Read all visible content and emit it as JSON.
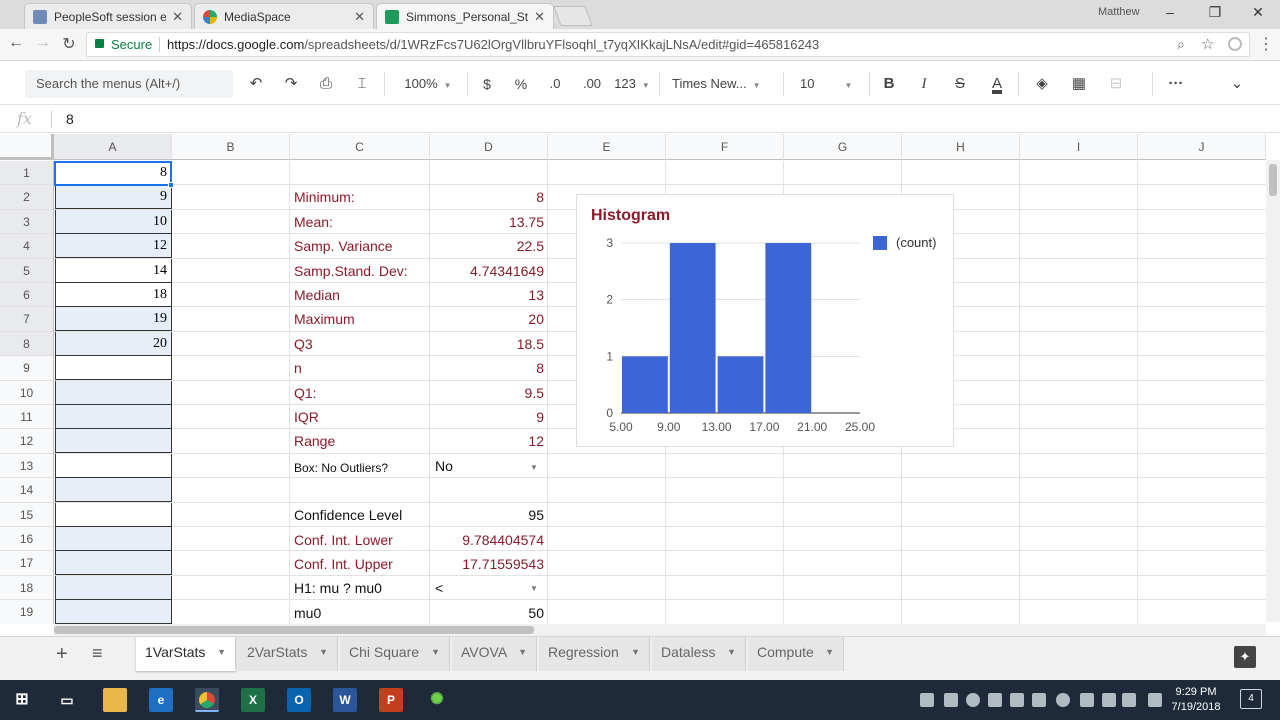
{
  "browser": {
    "tabs": [
      {
        "title": "PeopleSoft session expire",
        "close": "✕"
      },
      {
        "title": "MediaSpace",
        "close": "✕"
      },
      {
        "title": "Simmons_Personal_Stats_",
        "close": "✕"
      }
    ],
    "user": "Matthew",
    "window_controls": [
      "–",
      "❐",
      "✕"
    ],
    "secure_label": "Secure",
    "url_host": "https://docs.google.com",
    "url_path": "/spreadsheets/d/1WRzFcs7U62lOrgVllbruYFlsoqhl_t7yqXIKkajLNsA/edit#gid=465816243"
  },
  "toolbar": {
    "search_placeholder": "Search the menus (Alt+/)",
    "zoom": "100%",
    "currency": "$",
    "percent": "%",
    "dec_less": ".0",
    "dec_more": ".00",
    "format": "123",
    "font": "Times New...",
    "font_size": "10",
    "bold": "B",
    "italic": "I",
    "strike": "S",
    "text_color": "A",
    "more": "···"
  },
  "formula_bar": {
    "fx": "fx",
    "value": "8"
  },
  "columns": [
    "A",
    "B",
    "C",
    "D",
    "E",
    "F",
    "G",
    "H",
    "I",
    "J"
  ],
  "rows": [
    "1",
    "2",
    "3",
    "4",
    "5",
    "6",
    "7",
    "8",
    "9",
    "10",
    "11",
    "12",
    "13",
    "14",
    "15",
    "16",
    "17",
    "18",
    "19"
  ],
  "colA": [
    "8",
    "9",
    "10",
    "12",
    "14",
    "18",
    "19",
    "20"
  ],
  "stats": [
    {
      "label": "Minimum:",
      "value": "8"
    },
    {
      "label": "Mean:",
      "value": "13.75"
    },
    {
      "label": "Samp. Variance",
      "value": "22.5"
    },
    {
      "label": "Samp.Stand. Dev:",
      "value": "4.74341649"
    },
    {
      "label": "Median",
      "value": "13"
    },
    {
      "label": "Maximum",
      "value": "20"
    },
    {
      "label": "Q3",
      "value": "18.5"
    },
    {
      "label": "n",
      "value": "8"
    },
    {
      "label": "Q1:",
      "value": "9.5"
    },
    {
      "label": "IQR",
      "value": "9"
    },
    {
      "label": "Range",
      "value": "12"
    }
  ],
  "box_row": {
    "label": "Box:  No Outliers?",
    "value": "No"
  },
  "conf": [
    {
      "label": "Confidence Level",
      "value": "95"
    },
    {
      "label": "Conf. Int. Lower",
      "value": "9.784404574"
    },
    {
      "label": "Conf. Int. Upper",
      "value": "17.71559543"
    }
  ],
  "h1_row": {
    "label": "H1:  mu ? mu0",
    "value": "<"
  },
  "mu0_row": {
    "label": "mu0",
    "value": "50"
  },
  "chart_data": {
    "type": "bar",
    "title": "Histogram",
    "series": [
      {
        "name": "(count)",
        "values": [
          1,
          3,
          1,
          3
        ]
      }
    ],
    "bins": [
      [
        5,
        9
      ],
      [
        9,
        13
      ],
      [
        13,
        17
      ],
      [
        17,
        21
      ]
    ],
    "x_ticks": [
      "5.00",
      "9.00",
      "13.00",
      "17.00",
      "21.00",
      "25.00"
    ],
    "y_ticks": [
      "0",
      "1",
      "2",
      "3"
    ],
    "ylim": [
      0,
      3
    ],
    "xlim": [
      5,
      25
    ],
    "grid": true,
    "legend_position": "right",
    "bar_color": "#3c66d6"
  },
  "sheets": [
    {
      "name": "1VarStats"
    },
    {
      "name": "2VarStats"
    },
    {
      "name": "Chi Square"
    },
    {
      "name": "AVOVA"
    },
    {
      "name": "Regression"
    },
    {
      "name": "Dataless"
    },
    {
      "name": "Compute"
    }
  ],
  "clock": {
    "time": "9:29 PM",
    "date": "7/19/2018"
  },
  "notification_count": "4",
  "colors": {
    "label_red": "#8a1c2a",
    "bar_blue": "#3c66d6",
    "secure_green": "#0b8043"
  }
}
